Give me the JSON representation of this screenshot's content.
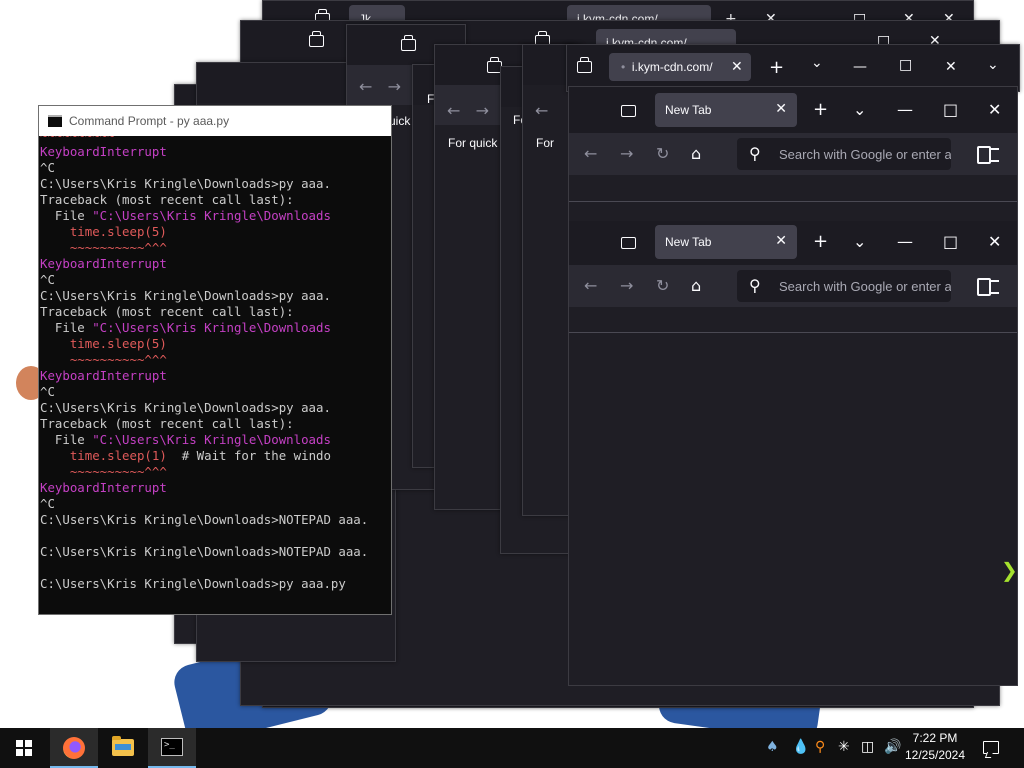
{
  "colors": {
    "desktop": "#ffffff",
    "browser_bg": "#1f1e25",
    "browser_toolbar": "#2b2a33",
    "tab_active": "#42414d",
    "cmd_bg": "#0c0c0c",
    "cmd_magenta": "#c440c4",
    "cmd_red": "#e05a5a",
    "taskbar": "#101010"
  },
  "background_windows": {
    "partial_tab_labels": [
      "i.kym-cdn.com/",
      "i.kym-cdn.com/",
      "Jk"
    ],
    "quick_access_label": "For quick a",
    "quick_access_label_short": "Fo",
    "quick_access_label_cut": "For"
  },
  "top_browser": {
    "tab_label": "i.kym-cdn.com/",
    "tab_close": "✕",
    "new_tab": "+",
    "list_tabs": "⌄",
    "minimize": "—",
    "maximize": "□",
    "close": "✕"
  },
  "front_browser": {
    "windows": [
      {
        "tab_label": "New Tab",
        "search_placeholder": "Search with Google or enter address"
      },
      {
        "tab_label": "New Tab",
        "search_placeholder": "Search with Google or enter address"
      }
    ]
  },
  "cmd": {
    "title": "Command Prompt - py  aaa.py",
    "lines": [
      "KeyboardInterrupt",
      "^C",
      "C:\\Users\\Kris Kringle\\Downloads>py aaa.",
      "Traceback (most recent call last):",
      "  File \"C:\\Users\\Kris Kringle\\Downloads",
      "    time.sleep(5)",
      "    ~~~~~~~~~~^^^",
      "KeyboardInterrupt",
      "^C",
      "C:\\Users\\Kris Kringle\\Downloads>py aaa.",
      "Traceback (most recent call last):",
      "  File \"C:\\Users\\Kris Kringle\\Downloads",
      "    time.sleep(5)",
      "    ~~~~~~~~~~^^^",
      "KeyboardInterrupt",
      "^C",
      "C:\\Users\\Kris Kringle\\Downloads>py aaa.",
      "Traceback (most recent call last):",
      "  File \"C:\\Users\\Kris Kringle\\Downloads",
      "    time.sleep(1)",
      "  # Wait for the windo",
      "    ~~~~~~~~~~^^^",
      "KeyboardInterrupt",
      "^C",
      "C:\\Users\\Kris Kringle\\Downloads>NOTEPAD aaa.",
      "",
      "C:\\Users\\Kris Kringle\\Downloads>NOTEPAD aaa.",
      "",
      "C:\\Users\\Kris Kringle\\Downloads>py aaa.py",
      "~~~~~~~~~~^^^"
    ]
  },
  "taskbar": {
    "start_icon": "windows-logo",
    "apps": [
      "firefox",
      "file-explorer",
      "command-prompt"
    ],
    "clock_time": "7:22 PM",
    "clock_date": "12/25/2024",
    "tray_icons": [
      "people-icon",
      "drop-icon",
      "search-tray-icon",
      "asterisk-icon",
      "network-icon",
      "volume-icon"
    ]
  }
}
